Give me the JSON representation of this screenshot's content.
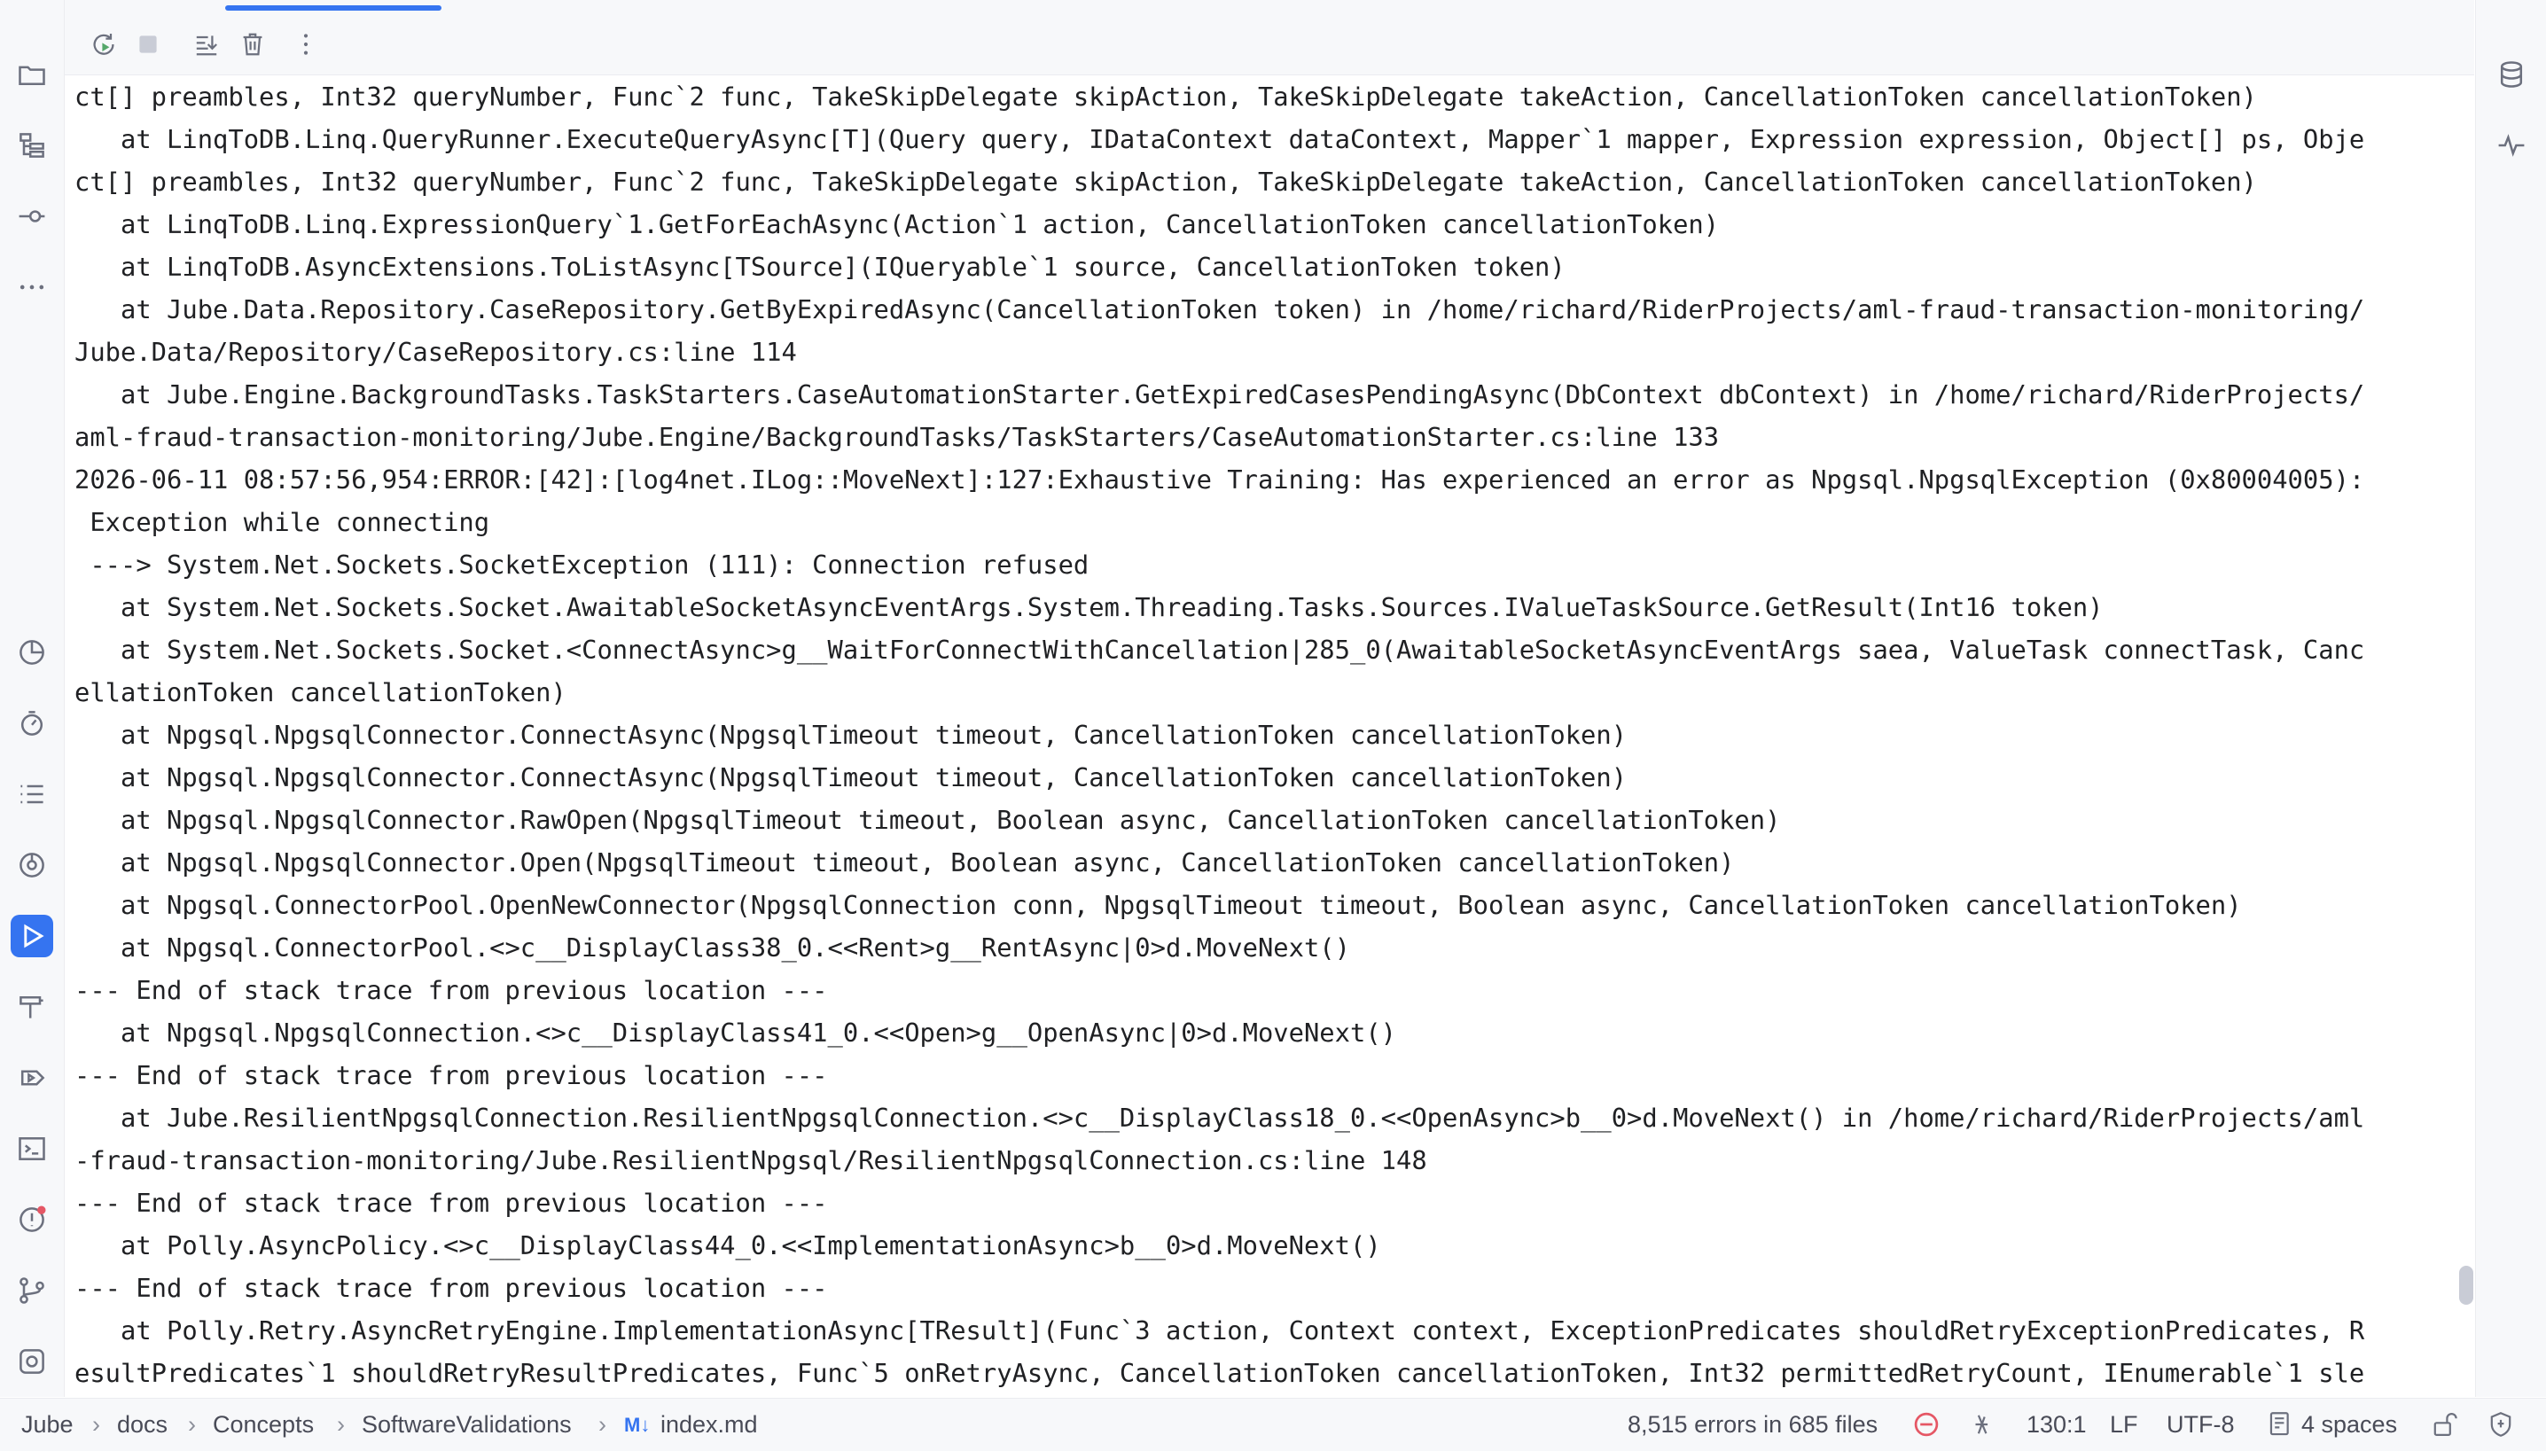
{
  "console": {
    "lines": [
      "ct[] preambles, Int32 queryNumber, Func`2 func, TakeSkipDelegate skipAction, TakeSkipDelegate takeAction, CancellationToken cancellationToken)",
      "   at LinqToDB.Linq.QueryRunner.ExecuteQueryAsync[T](Query query, IDataContext dataContext, Mapper`1 mapper, Expression expression, Object[] ps, Obje",
      "ct[] preambles, Int32 queryNumber, Func`2 func, TakeSkipDelegate skipAction, TakeSkipDelegate takeAction, CancellationToken cancellationToken)",
      "   at LinqToDB.Linq.ExpressionQuery`1.GetForEachAsync(Action`1 action, CancellationToken cancellationToken)",
      "   at LinqToDB.AsyncExtensions.ToListAsync[TSource](IQueryable`1 source, CancellationToken token)",
      "   at Jube.Data.Repository.CaseRepository.GetByExpiredAsync(CancellationToken token) in /home/richard/RiderProjects/aml-fraud-transaction-monitoring/",
      "Jube.Data/Repository/CaseRepository.cs:line 114",
      "   at Jube.Engine.BackgroundTasks.TaskStarters.CaseAutomationStarter.GetExpiredCasesPendingAsync(DbContext dbContext) in /home/richard/RiderProjects/",
      "aml-fraud-transaction-monitoring/Jube.Engine/BackgroundTasks/TaskStarters/CaseAutomationStarter.cs:line 133",
      "2026-06-11 08:57:56,954:ERROR:[42]:[log4net.ILog::MoveNext]:127:Exhaustive Training: Has experienced an error as Npgsql.NpgsqlException (0x80004005):",
      " Exception while connecting",
      " ---> System.Net.Sockets.SocketException (111): Connection refused",
      "   at System.Net.Sockets.Socket.AwaitableSocketAsyncEventArgs.System.Threading.Tasks.Sources.IValueTaskSource.GetResult(Int16 token)",
      "   at System.Net.Sockets.Socket.<ConnectAsync>g__WaitForConnectWithCancellation|285_0(AwaitableSocketAsyncEventArgs saea, ValueTask connectTask, Canc",
      "ellationToken cancellationToken)",
      "   at Npgsql.NpgsqlConnector.ConnectAsync(NpgsqlTimeout timeout, CancellationToken cancellationToken)",
      "   at Npgsql.NpgsqlConnector.ConnectAsync(NpgsqlTimeout timeout, CancellationToken cancellationToken)",
      "   at Npgsql.NpgsqlConnector.RawOpen(NpgsqlTimeout timeout, Boolean async, CancellationToken cancellationToken)",
      "   at Npgsql.NpgsqlConnector.Open(NpgsqlTimeout timeout, Boolean async, CancellationToken cancellationToken)",
      "   at Npgsql.ConnectorPool.OpenNewConnector(NpgsqlConnection conn, NpgsqlTimeout timeout, Boolean async, CancellationToken cancellationToken)",
      "   at Npgsql.ConnectorPool.<>c__DisplayClass38_0.<<Rent>g__RentAsync|0>d.MoveNext()",
      "--- End of stack trace from previous location ---",
      "   at Npgsql.NpgsqlConnection.<>c__DisplayClass41_0.<<Open>g__OpenAsync|0>d.MoveNext()",
      "--- End of stack trace from previous location ---",
      "   at Jube.ResilientNpgsqlConnection.ResilientNpgsqlConnection.<>c__DisplayClass18_0.<<OpenAsync>b__0>d.MoveNext() in /home/richard/RiderProjects/aml",
      "-fraud-transaction-monitoring/Jube.ResilientNpgsql/ResilientNpgsqlConnection.cs:line 148",
      "--- End of stack trace from previous location ---",
      "   at Polly.AsyncPolicy.<>c__DisplayClass44_0.<<ImplementationAsync>b__0>d.MoveNext()",
      "--- End of stack trace from previous location ---",
      "   at Polly.Retry.AsyncRetryEngine.ImplementationAsync[TResult](Func`3 action, Context context, ExceptionPredicates shouldRetryExceptionPredicates, R",
      "esultPredicates`1 shouldRetryResultPredicates, Func`5 onRetryAsync, CancellationToken cancellationToken, Int32 permittedRetryCount, IEnumerable`1 sle"
    ]
  },
  "toolbar": {
    "tools": [
      {
        "name": "rerun-icon",
        "icon": "rerun-icon"
      },
      {
        "name": "stop-icon",
        "icon": "stop-icon"
      },
      {
        "name": "scroll-to-end-icon",
        "icon": "scroll-to-end-icon"
      },
      {
        "name": "clear-all-icon",
        "icon": "trash-icon"
      },
      {
        "name": "more-options-icon",
        "icon": "kebab-icon"
      }
    ]
  },
  "left_sidebar": {
    "top_icons": [
      "project-folder-icon",
      "structure-icon",
      "commit-icon",
      "more-icon"
    ],
    "bottom_icons": [
      "coverage-icon",
      "profiler-icon",
      "todo-icon",
      "services-icon",
      "run-icon",
      "build-icon",
      "debug-icon",
      "terminal-icon",
      "problems-icon",
      "git-icon",
      "dotmemory-icon"
    ]
  },
  "right_sidebar": {
    "icons": [
      "database-icon",
      "dotTrace-icon"
    ]
  },
  "breadcrumb": {
    "items": [
      "Jube",
      "docs",
      "Concepts",
      "SoftwareValidations"
    ],
    "file_badge": "M↓",
    "file_name": "index.md"
  },
  "status": {
    "errors": "8,515 errors in 685 files",
    "position": "130:1",
    "line_ending": "LF",
    "encoding": "UTF-8",
    "indent": "4 spaces"
  },
  "colors": {
    "accent": "#3574f0",
    "error": "#e55765",
    "notification_dot": "#e55765"
  }
}
